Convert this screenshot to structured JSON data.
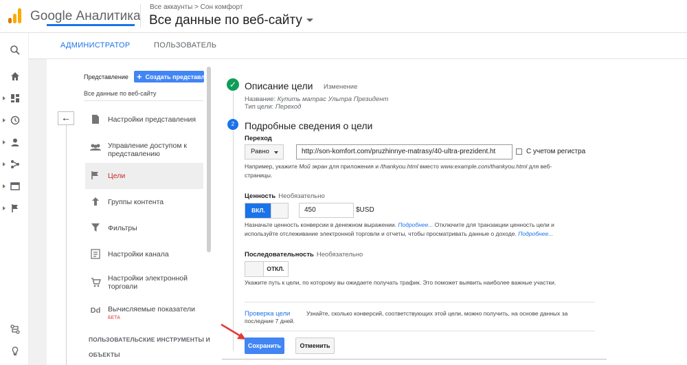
{
  "header": {
    "brand": "Google Аналитика",
    "breadcrumb": "Все аккаунты > Сон комфорт",
    "property": "Все данные по веб-сайту",
    "colors": {
      "accent": "#1a73e8",
      "logo_orange": "#f9ab00",
      "logo_dark": "#e37400"
    }
  },
  "rail": {
    "icons": [
      "search-icon",
      "home-icon",
      "dashboard-icon",
      "clock-icon",
      "person-icon",
      "acquisition-icon",
      "behavior-icon",
      "flag-icon",
      "connect-icon",
      "lightbulb-icon"
    ]
  },
  "tabs": [
    {
      "label": "АДМИНИСТРАТОР"
    },
    {
      "label": "ПОЛЬЗОВАТЕЛЬ"
    }
  ],
  "view": {
    "label": "Представление",
    "create_button": "Создать представление",
    "name": "Все данные по веб-сайту"
  },
  "menu": {
    "items": [
      {
        "label": "Настройки представления",
        "icon": "doc-icon"
      },
      {
        "label": "Управление доступом к представлению",
        "icon": "people-icon"
      },
      {
        "label": "Цели",
        "icon": "flag-icon"
      },
      {
        "label": "Группы контента",
        "icon": "content-group-icon"
      },
      {
        "label": "Фильтры",
        "icon": "filter-icon"
      },
      {
        "label": "Настройки канала",
        "icon": "channel-icon"
      },
      {
        "label": "Настройки электронной торговли",
        "icon": "cart-icon"
      },
      {
        "label": "Вычисляемые показатели",
        "icon": "dd-icon",
        "badge": "БЕТА"
      }
    ],
    "section_heading": "ПОЛЬЗОВАТЕЛЬСКИЕ ИНСТРУМЕНТЫ И",
    "section_heading2": "ОБЪЕКТЫ"
  },
  "goal": {
    "description_title": "Описание цели",
    "edit_link": "Изменение",
    "name_label": "Название:",
    "name_value": "Купить матрас Ультра Президент",
    "type_label": "Тип цели:",
    "type_value": "Переход",
    "step_number": "2",
    "details_title": "Подробные сведения о цели",
    "destination_label": "Переход",
    "match_type": "Равно",
    "url": "http://son-komfort.com/pruzhinnye-matrasy/40-ultra-prezident.ht",
    "case_sensitive": "С учетом регистра",
    "url_hint_pre": "Например, укажите",
    "url_hint_app": "Мой экран",
    "url_hint_mid": "для приложения и",
    "url_hint_thanks": "/thankyou.html",
    "url_hint_instead": "вместо",
    "url_hint_example": "www.example.com/thankyou.html",
    "url_hint_post": "для веб-",
    "url_hint_line2": "страницы.",
    "value_label": "Ценность",
    "optional": "Необязательно",
    "value_toggle": "ВКЛ.",
    "value": "450",
    "currency": "$USD",
    "value_hint1_pre": "Назначьте ценность конверсии в денежном выражении.",
    "more": "Подробнее...",
    "value_hint1_post": "Отключите для транзакции ценность цели и",
    "value_hint2": "используйте отслеживание электронной торговли и отчеты, чтобы просматривать данные о доходе.",
    "funnel_label": "Последовательность",
    "funnel_toggle": "ОТКЛ.",
    "funnel_hint": "Укажите путь к цели, по которому вы ожидаете получать трафик. Это поможет выявить наиболее важные участки.",
    "verify_link": "Проверка цели",
    "verify_text": "Узнайте, сколько конверсий, соответствующих этой цели, можно получить, на основе данных за",
    "verify_text2": "последние 7 дней.",
    "save": "Сохранить",
    "cancel": "Отменить"
  }
}
